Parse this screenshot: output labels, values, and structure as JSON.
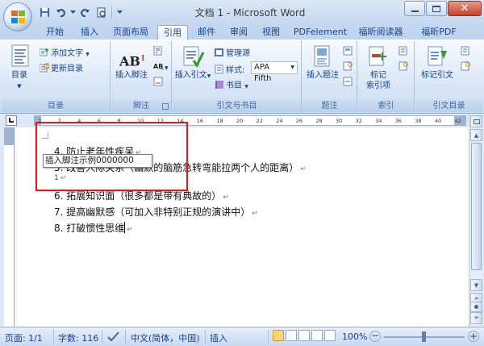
{
  "window": {
    "title": "文档 1 - Microsoft Word"
  },
  "tabs": [
    {
      "label": "开始",
      "active": false
    },
    {
      "label": "插入",
      "active": false
    },
    {
      "label": "页面布局",
      "active": false
    },
    {
      "label": "引用",
      "active": true
    },
    {
      "label": "邮件",
      "active": false
    },
    {
      "label": "审阅",
      "active": false
    },
    {
      "label": "视图",
      "active": false
    },
    {
      "label": "PDFelement",
      "active": false
    },
    {
      "label": "福昕阅读器",
      "active": false
    },
    {
      "label": "福昕PDF",
      "active": false
    }
  ],
  "ribbon": {
    "toc": {
      "button": "目录",
      "add_text": "添加文字",
      "update": "更新目录",
      "label": "目录"
    },
    "footnotes": {
      "insert": "插入脚注",
      "ab_icon": "AB",
      "label": "脚注"
    },
    "citations": {
      "insert_citation": "插入引文",
      "manage_sources": "管理源",
      "style_label": "样式:",
      "style_value": "APA Fifth",
      "bibliography": "书目",
      "label": "引文与书目"
    },
    "captions": {
      "insert_caption": "插入题注",
      "label": "题注"
    },
    "index": {
      "mark_entry_line1": "标记",
      "mark_entry_line2": "索引项",
      "label": "索引"
    },
    "toa": {
      "mark_citation": "标记引文",
      "label": "引文目录"
    }
  },
  "ruler": {
    "ticks": [
      "2",
      "2",
      "4",
      "6",
      "8",
      "10",
      "12",
      "14",
      "16",
      "18",
      "20",
      "22",
      "24",
      "26",
      "28",
      "30",
      "32",
      "34",
      "36",
      "38",
      "40",
      "42"
    ]
  },
  "document": {
    "lines": [
      {
        "text": "4. 防止老年性疾呆",
        "mark": "↵"
      },
      {
        "text": "5. 改善人际关系（幽默的脑筋急转弯能拉两个人的距离）",
        "mark": "↵"
      },
      {
        "text": "",
        "mark": "↵"
      },
      {
        "text": "6. 拓展知识面（很多都是带有典故的）",
        "mark": "↵"
      },
      {
        "text": "7. 提高幽默感（可加入非特别正规的演讲中）",
        "mark": "↵"
      },
      {
        "text": "8. 打破惯性思维",
        "mark": "↵"
      }
    ],
    "footnote_ref": "1",
    "tooltip": "插入脚注示例0000000"
  },
  "status": {
    "page": "页面: 1/1",
    "words": "字数: 116",
    "language": "中文(简体，中国)",
    "mode": "插入",
    "zoom": "100%"
  },
  "colors": {
    "accent": "#15428b",
    "highlight_box": "#e01818",
    "ribbon_bg": "#dbe7f7"
  }
}
